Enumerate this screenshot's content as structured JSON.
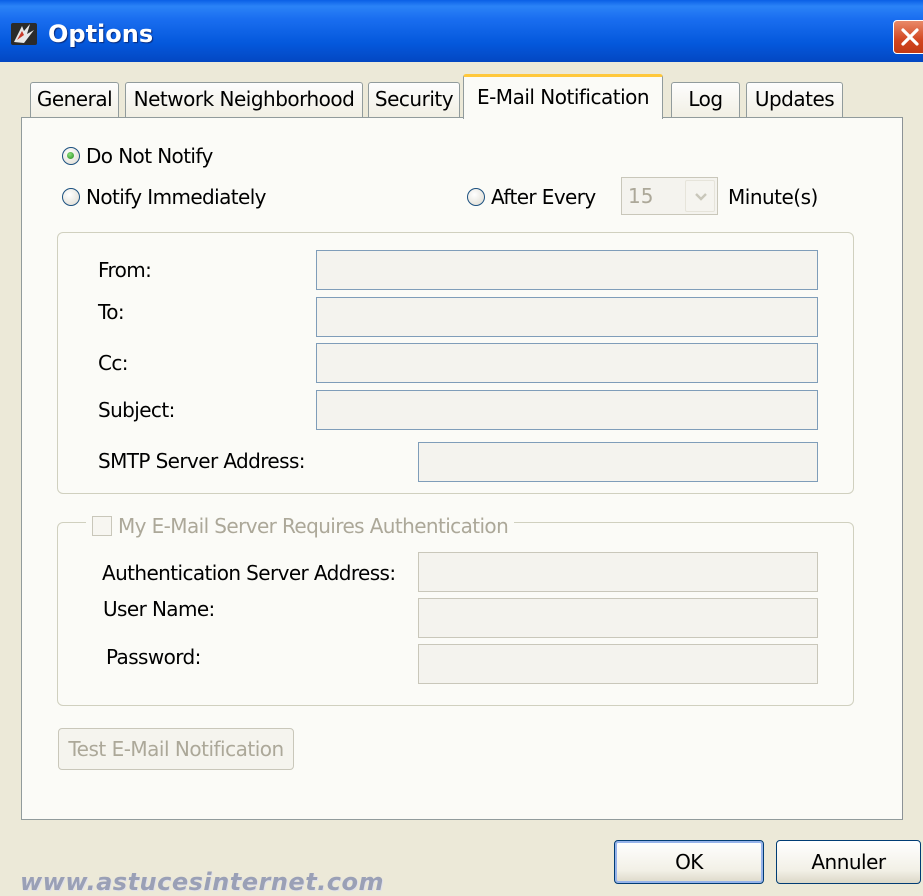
{
  "window": {
    "title": "Options"
  },
  "tabs": [
    {
      "label": "General"
    },
    {
      "label": "Network Neighborhood"
    },
    {
      "label": "Security"
    },
    {
      "label": "E-Mail Notification",
      "active": true
    },
    {
      "label": "Log"
    },
    {
      "label": "Updates"
    }
  ],
  "notify": {
    "do_not_notify": {
      "label": "Do Not Notify",
      "checked": true
    },
    "notify_immediately": {
      "label": "Notify Immediately",
      "checked": false
    },
    "after_every": {
      "label": "After Every",
      "checked": false
    },
    "interval_value": "15",
    "interval_unit": "Minute(s)"
  },
  "email": {
    "from_label": "From:",
    "to_label": "To:",
    "cc_label": "Cc:",
    "subject_label": "Subject:",
    "smtp_label": "SMTP Server Address:"
  },
  "auth": {
    "checkbox_label": "My E-Mail Server Requires Authentication",
    "server_label": "Authentication Server Address:",
    "username_label": "User Name:",
    "password_label": "Password:"
  },
  "buttons": {
    "test": "Test E-Mail Notification",
    "ok": "OK",
    "cancel": "Annuler"
  },
  "watermark": "www.astucesinternet.com",
  "colors": {
    "titlebar": "#0458dc",
    "active_tab_accent": "#ffc83c",
    "close_button": "#d2451f"
  }
}
